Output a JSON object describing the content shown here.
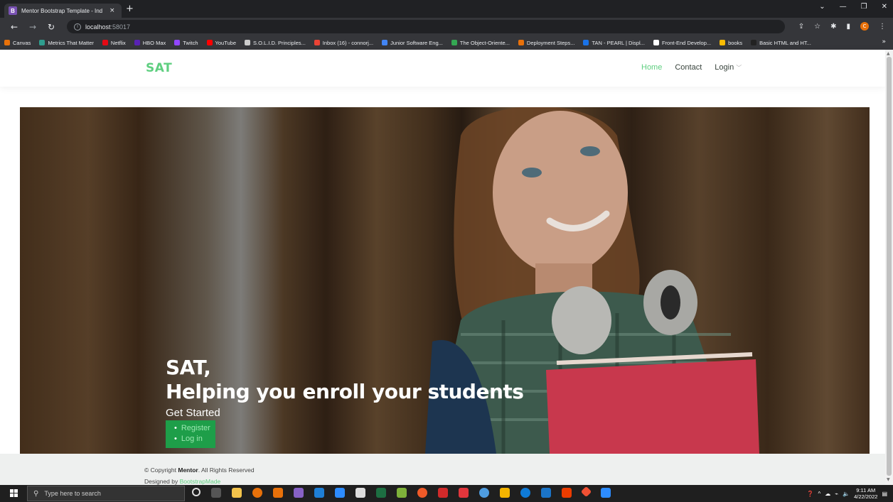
{
  "browser": {
    "tab_title": "Mentor Bootstrap Template - Ind",
    "tab_favicon": "B",
    "tab_close": "×",
    "new_tab": "+",
    "url_host": "localhost",
    "url_port": ":58017",
    "profile_initial": "C",
    "bookmarks": [
      {
        "label": "Canvas",
        "color": "#e8710a"
      },
      {
        "label": "Metrics That Matter",
        "color": "#2f9e8f"
      },
      {
        "label": "Netflix",
        "color": "#e50914"
      },
      {
        "label": "HBO Max",
        "color": "#5822b4"
      },
      {
        "label": "Twitch",
        "color": "#9146ff"
      },
      {
        "label": "YouTube",
        "color": "#ff0000"
      },
      {
        "label": "S.O.L.I.D. Principles...",
        "color": "#cccccc"
      },
      {
        "label": "Inbox (16) - connorj...",
        "color": "#ea4335"
      },
      {
        "label": "Junior Software Eng...",
        "color": "#4285f4"
      },
      {
        "label": "The Object-Oriente...",
        "color": "#34a853"
      },
      {
        "label": "Deployment Steps...",
        "color": "#e8710a"
      },
      {
        "label": "TAN - PEARL | Displ...",
        "color": "#1a73e8"
      },
      {
        "label": "Front-End Develop...",
        "color": "#ffffff"
      },
      {
        "label": "books",
        "color": "#fbbc04"
      },
      {
        "label": "Basic HTML and HT...",
        "color": "#222222"
      }
    ],
    "bookmarks_more": "»"
  },
  "header": {
    "logo": "SAT",
    "nav": [
      {
        "label": "Home",
        "active": true
      },
      {
        "label": "Contact",
        "active": false
      },
      {
        "label": "Login",
        "active": false
      }
    ]
  },
  "hero": {
    "title_line1": "SAT,",
    "title_line2": "Helping you enroll your students",
    "subtitle": "Get Started",
    "links": [
      "Register",
      "Log in"
    ]
  },
  "footer": {
    "copyright_prefix": "© Copyright ",
    "copyright_brand": "Mentor",
    "copyright_suffix": ". All Rights Reserved",
    "designed_by": "Designed by ",
    "designer": "BootstrapMade"
  },
  "taskbar": {
    "search_placeholder": "Type here to search",
    "time": "9:11 AM",
    "date": "4/22/2022"
  },
  "colors": {
    "accent": "#5fcf80",
    "button": "#1e9e49"
  }
}
